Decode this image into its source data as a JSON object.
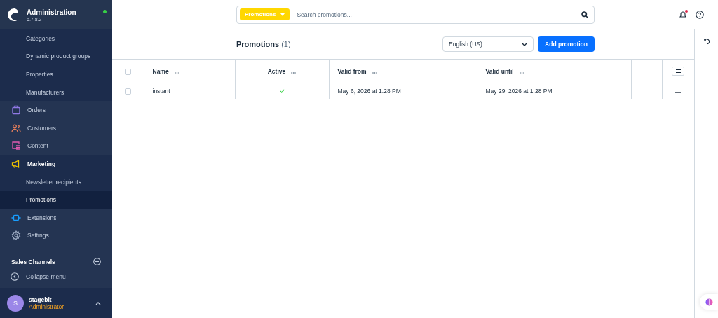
{
  "brand": {
    "title": "Administration",
    "version": "6.7.8.2",
    "online": true
  },
  "sidebar": {
    "items": [
      {
        "label": "Categories",
        "kind": "sub",
        "selected": false
      },
      {
        "label": "Dynamic product groups",
        "kind": "sub",
        "selected": false
      },
      {
        "label": "Properties",
        "kind": "sub",
        "selected": false
      },
      {
        "label": "Manufacturers",
        "kind": "sub",
        "selected": false
      },
      {
        "label": "Orders",
        "kind": "main",
        "expanded": false,
        "selected": false
      },
      {
        "label": "Customers",
        "kind": "main",
        "expanded": false,
        "selected": false
      },
      {
        "label": "Content",
        "kind": "main",
        "expanded": false,
        "selected": false
      },
      {
        "label": "Marketing",
        "kind": "main",
        "expanded": true,
        "selected": false
      },
      {
        "label": "Newsletter recipients",
        "kind": "sub",
        "selected": false
      },
      {
        "label": "Promotions",
        "kind": "sub",
        "selected": true
      },
      {
        "label": "Extensions",
        "kind": "main",
        "expanded": false,
        "selected": false
      },
      {
        "label": "Settings",
        "kind": "main",
        "expanded": false,
        "selected": false
      }
    ],
    "sales_channels": "Sales Channels",
    "collapse": "Collapse menu"
  },
  "user": {
    "initial": "S",
    "name": "stagebit",
    "role": "Administrator"
  },
  "search": {
    "scope": "Promotions",
    "placeholder": "Search promotions..."
  },
  "notifications": {
    "unread": true
  },
  "page": {
    "title": "Promotions",
    "count": "(1)",
    "language": "English (US)",
    "add_button": "Add promotion"
  },
  "table": {
    "columns": [
      {
        "label": "Name"
      },
      {
        "label": "Active"
      },
      {
        "label": "Valid from"
      },
      {
        "label": "Valid until"
      }
    ],
    "rows": [
      {
        "checked": false,
        "name": "instant",
        "active": true,
        "valid_from": "May 6, 2026 at 1:28 PM",
        "valid_until": "May 29, 2026 at 1:28 PM"
      }
    ]
  },
  "header_checked": false
}
